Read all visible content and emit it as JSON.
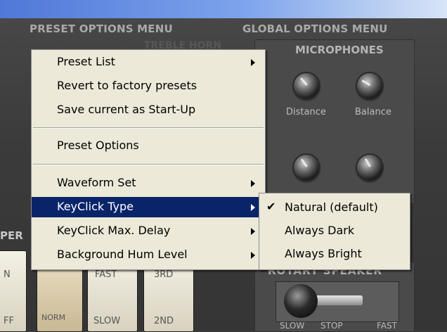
{
  "headers": {
    "preset_options_menu": "PRESET OPTIONS MENU",
    "global_options_menu": "GLOBAL OPTIONS MENU",
    "microphones": "MICROPHONES",
    "treble_horn_partial": "TREBLE HORN",
    "rotary_speaker": "ROTARY SPEAKER",
    "percussion_partial": "PER"
  },
  "knobs": {
    "distance_label": "Distance",
    "balance_label": "Balance"
  },
  "rotary": {
    "slow": "SLOW",
    "stop": "STOP",
    "fast": "FAST"
  },
  "tabs": {
    "tab1_top": "N",
    "tab1_bottom": "FF",
    "tab2_bottom": "NORM",
    "tab3_top": "FAST",
    "tab3_bottom": "SLOW",
    "tab4_top": "3RD",
    "tab4_bottom": "2ND"
  },
  "context_menu": {
    "items": [
      {
        "label": "Preset List",
        "has_submenu": true
      },
      {
        "label": "Revert to factory presets",
        "has_submenu": false
      },
      {
        "label": "Save current as Start-Up",
        "has_submenu": false
      },
      {
        "label": "Preset Options",
        "has_submenu": false
      },
      {
        "label": "Waveform Set",
        "has_submenu": true
      },
      {
        "label": "KeyClick Type",
        "has_submenu": true,
        "highlighted": true
      },
      {
        "label": "KeyClick Max. Delay",
        "has_submenu": true
      },
      {
        "label": "Background Hum Level",
        "has_submenu": true
      }
    ]
  },
  "submenu": {
    "items": [
      {
        "label": "Natural (default)",
        "checked": true
      },
      {
        "label": "Always Dark",
        "checked": false
      },
      {
        "label": "Always Bright",
        "checked": false
      }
    ],
    "check_glyph": "✔"
  },
  "colors": {
    "menu_bg": "#ece9d8",
    "highlight": "#0a246a",
    "panel_bg": "#3b3b3b",
    "titlebar": "#4f78d8"
  }
}
